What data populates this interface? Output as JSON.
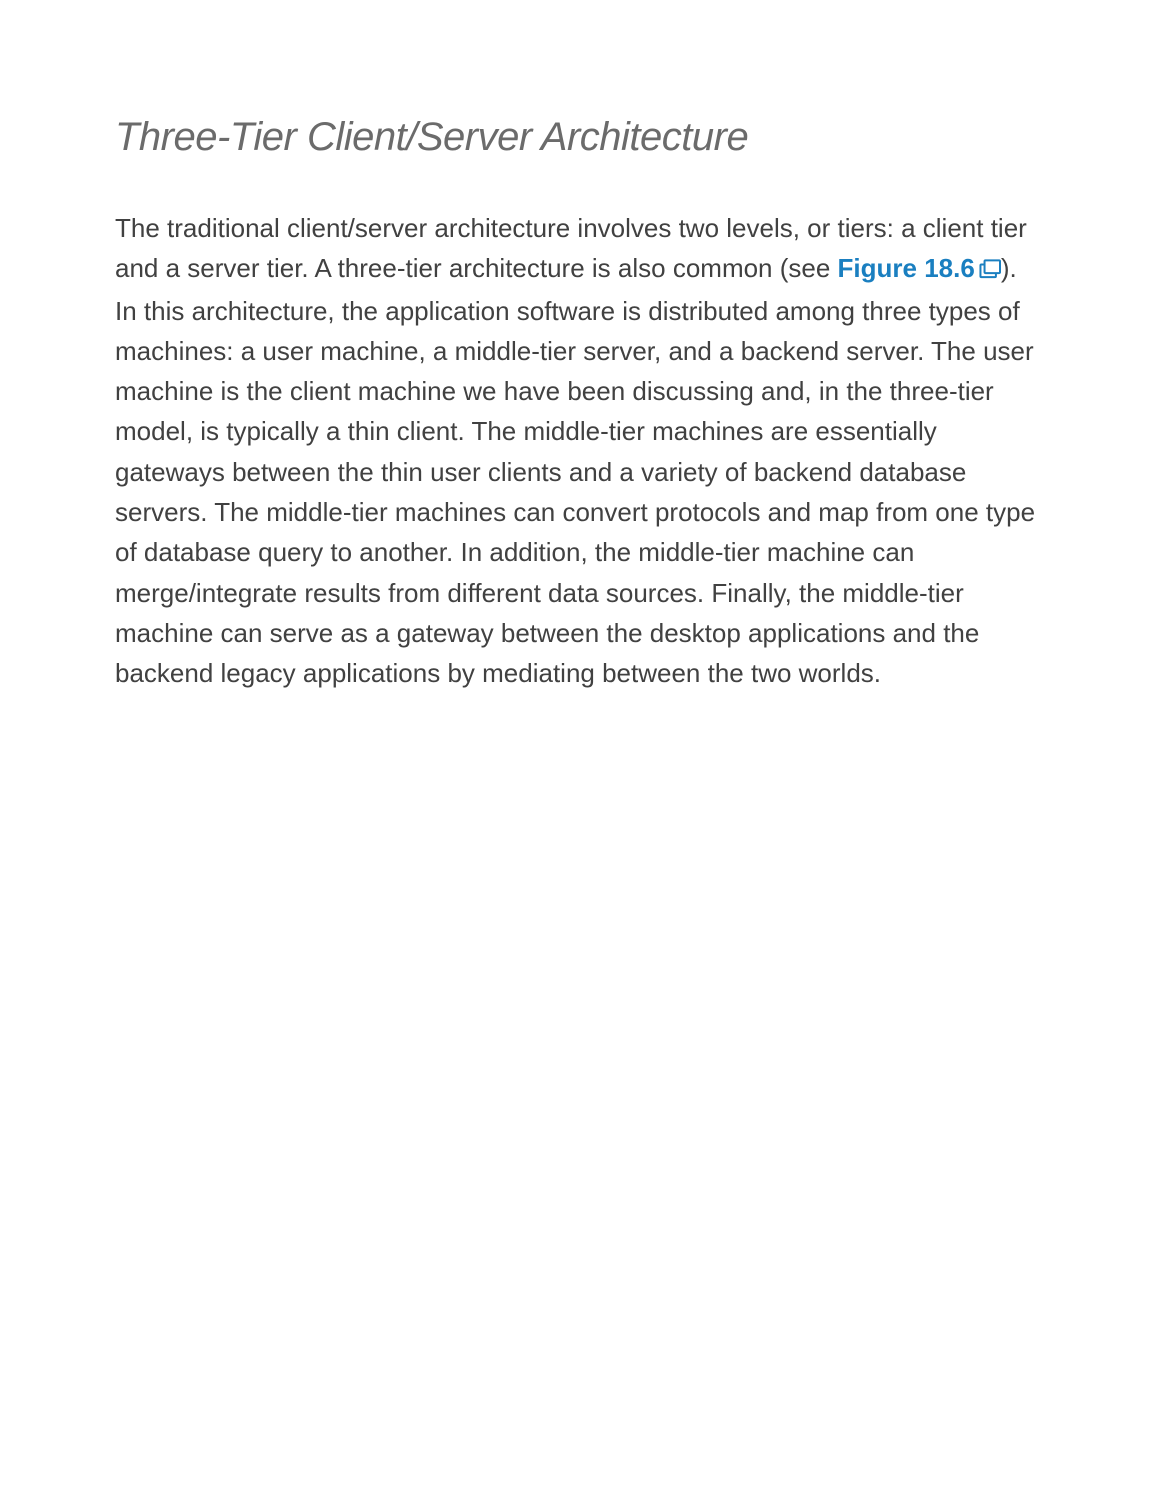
{
  "heading": "Three-Tier Client/Server Architecture",
  "paragraph": {
    "part1": "The traditional client/server architecture involves two levels, or tiers: a client tier and a server tier. A three-tier architecture is also common (see ",
    "figure_link_text": "Figure 18.6",
    "part2": "). In this architecture, the application software is distributed among three types of machines: a user machine, a middle-tier server, and a backend server. The user machine is the client machine we have been discussing and, in the three-tier model, is typically a thin client. The middle-tier machines are essentially gateways between the thin user clients and a variety of backend database servers. The middle-tier machines can convert protocols and map from one type of database query to another. In addition, the middle-tier machine can merge/integrate results from different data sources. Finally, the middle-tier machine can serve as a gateway between the desktop applications and the backend legacy applications by mediating between the two worlds."
  }
}
